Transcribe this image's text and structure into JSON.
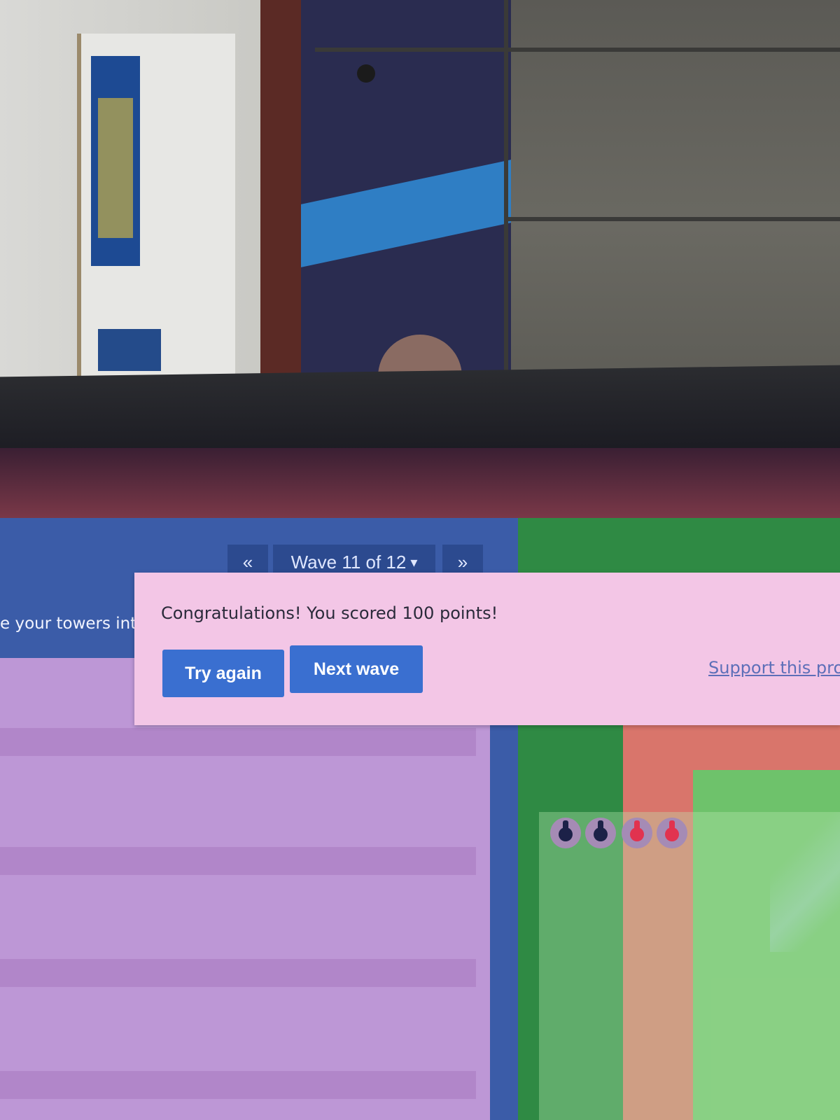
{
  "game": {
    "wave_nav": {
      "prev_label": "«",
      "wave_label": "Wave 11 of 12",
      "dropdown_glyph": "▾",
      "next_label": "»"
    },
    "hint_text": "e your towers int",
    "dialog": {
      "message": "Congratulations! You scored 100 points!",
      "try_again_label": "Try again",
      "next_wave_label": "Next wave",
      "support_link": "Support this pro"
    },
    "towers": [
      "dark",
      "dark",
      "red",
      "red"
    ]
  },
  "colors": {
    "panel_blue": "#3b5ca8",
    "dialog_pink": "#f3c6e6",
    "button_blue": "#3a6fd0",
    "grass_green": "#2f8a44",
    "path_red": "#d9756b",
    "lilac": "#bd97d6"
  }
}
